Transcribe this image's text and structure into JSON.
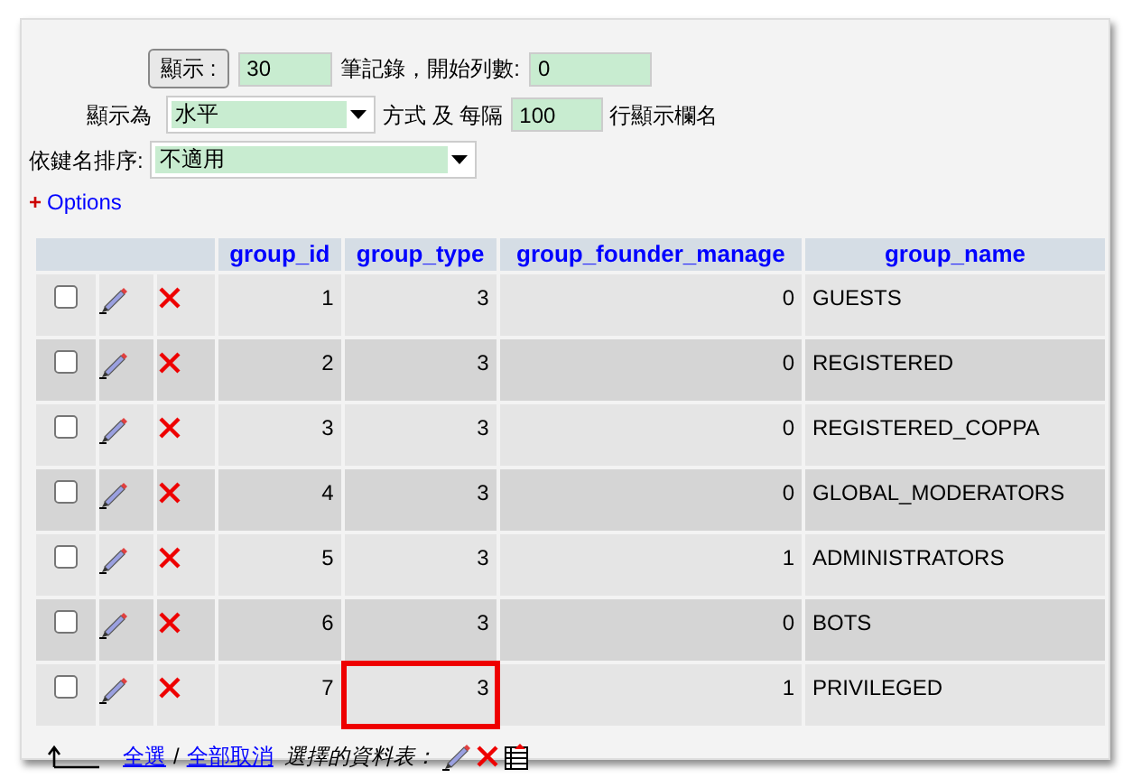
{
  "form": {
    "show_button": "顯示 :",
    "rows_value": "30",
    "rows_label": "筆記錄，開始列數:",
    "start_value": "0",
    "mode_label": "顯示為",
    "mode_value": "水平",
    "repeat_label": "方式 及 每隔",
    "repeat_value": "100",
    "repeat_suffix": "行顯示欄名",
    "sort_label": "依鍵名排序:",
    "sort_value": "不適用",
    "options_plus": "+",
    "options_link": "Options"
  },
  "table": {
    "columns": [
      "group_id",
      "group_type",
      "group_founder_manage",
      "group_name"
    ],
    "rows": [
      {
        "checked": false,
        "cells": [
          "1",
          "3",
          "0",
          "GUESTS"
        ],
        "highlighted": false
      },
      {
        "checked": false,
        "cells": [
          "2",
          "3",
          "0",
          "REGISTERED"
        ],
        "highlighted": false
      },
      {
        "checked": false,
        "cells": [
          "3",
          "3",
          "0",
          "REGISTERED_COPPA"
        ],
        "highlighted": false
      },
      {
        "checked": false,
        "cells": [
          "4",
          "3",
          "0",
          "GLOBAL_MODERATORS"
        ],
        "highlighted": false
      },
      {
        "checked": false,
        "cells": [
          "5",
          "3",
          "1",
          "ADMINISTRATORS"
        ],
        "highlighted": false
      },
      {
        "checked": false,
        "cells": [
          "6",
          "3",
          "0",
          "BOTS"
        ],
        "highlighted": false
      },
      {
        "checked": false,
        "cells": [
          "7",
          "3",
          "1",
          "PRIVILEGED"
        ],
        "highlighted": true
      }
    ]
  },
  "footer": {
    "check_all": "全選",
    "separator": "/",
    "uncheck_all": "全部取消",
    "with_selected": "選擇的資料表："
  }
}
